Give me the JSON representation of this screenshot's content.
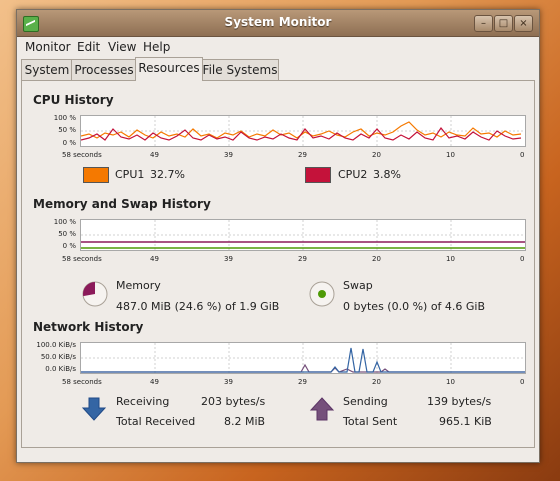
{
  "window": {
    "title": "System Monitor"
  },
  "menu": {
    "monitor": "Monitor",
    "edit": "Edit",
    "view": "View",
    "help": "Help"
  },
  "tabs": [
    "System",
    "Processes",
    "Resources",
    "File Systems"
  ],
  "cpu": {
    "title": "CPU History",
    "y_ticks": [
      "100 %",
      "50 %",
      "0 %"
    ],
    "x_ticks": [
      "58 seconds",
      "49",
      "39",
      "29",
      "20",
      "10",
      "0"
    ],
    "cpu1_label": "CPU1",
    "cpu1_value": "32.7%",
    "cpu1_color": "#f57900",
    "cpu2_label": "CPU2",
    "cpu2_value": "3.8%",
    "cpu2_color": "#c4123a"
  },
  "memory": {
    "title": "Memory and Swap History",
    "y_ticks": [
      "100 %",
      "50 %",
      "0 %"
    ],
    "x_ticks": [
      "58 seconds",
      "49",
      "39",
      "29",
      "20",
      "10",
      "0"
    ],
    "memory_label": "Memory",
    "memory_value": "487.0 MiB (24.6 %) of 1.9 GiB",
    "swap_label": "Swap",
    "swap_value": "0 bytes (0.0 %) of 4.6 GiB",
    "memory_color": "#8b1a5a",
    "swap_color": "#4e9a06"
  },
  "network": {
    "title": "Network History",
    "y_ticks": [
      "100.0 KiB/s",
      "50.0 KiB/s",
      "0.0 KiB/s"
    ],
    "x_ticks": [
      "58 seconds",
      "49",
      "39",
      "29",
      "20",
      "10",
      "0"
    ],
    "receiving_label": "Receiving",
    "receiving_value": "203 bytes/s",
    "total_received_label": "Total Received",
    "total_received_value": "8.2 MiB",
    "sending_label": "Sending",
    "sending_value": "139 bytes/s",
    "total_sent_label": "Total Sent",
    "total_sent_value": "965.1 KiB",
    "receiving_color": "#3465a4",
    "sending_color": "#75507b"
  }
}
